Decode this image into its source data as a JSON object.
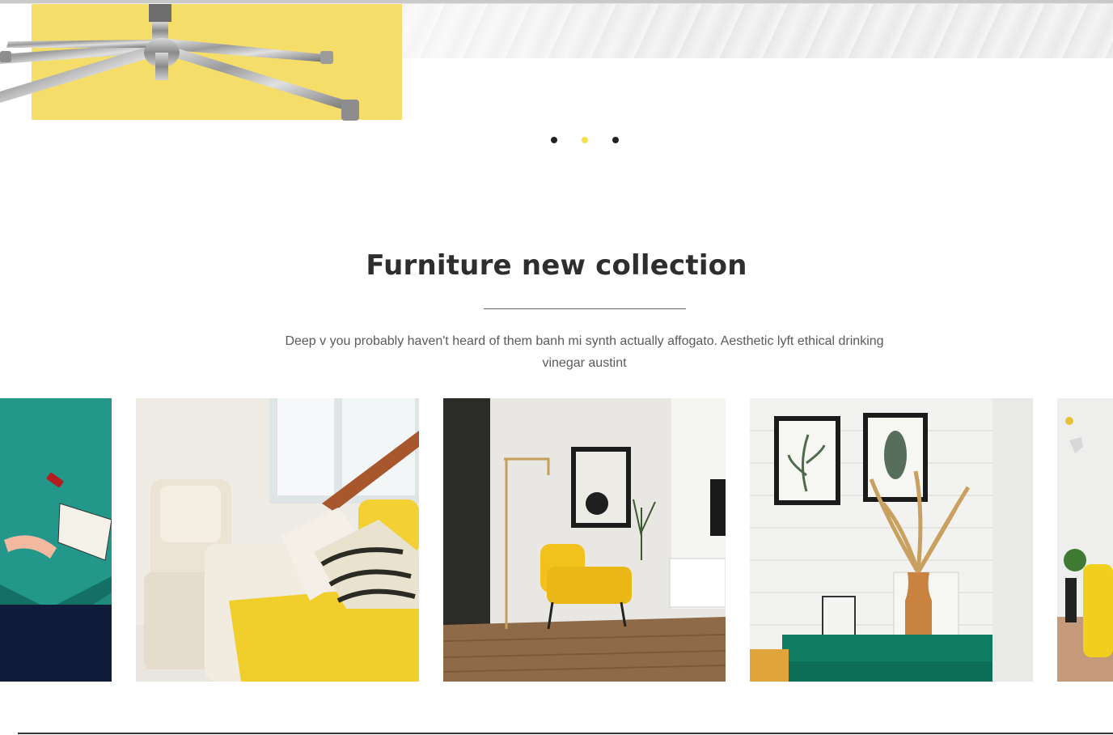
{
  "slider": {
    "dots": [
      {
        "label": "slide-1",
        "active": false
      },
      {
        "label": "slide-2",
        "active": true
      },
      {
        "label": "slide-3",
        "active": false
      }
    ],
    "active_color": "#f3e04a",
    "inactive_color": "#222222"
  },
  "section": {
    "title": "Furniture new collection",
    "description": "Deep v you probably haven't heard of them banh mi synth actually affogato. Aesthetic lyft ethical drinking vinegar austint"
  },
  "gallery": {
    "items": [
      {
        "name": "teal-desk-flatlay",
        "icon": "photo-icon"
      },
      {
        "name": "yellow-sofa-armchair-stairs",
        "icon": "photo-icon"
      },
      {
        "name": "yellow-armchair-floor-lamp",
        "icon": "photo-icon"
      },
      {
        "name": "green-console-dried-grass-vase",
        "icon": "photo-icon"
      },
      {
        "name": "yellow-sofa-plants",
        "icon": "photo-icon"
      }
    ]
  },
  "colors": {
    "hero_yellow": "#f5dd6a",
    "heading": "#2e2e2e",
    "body_text": "#5a5a5a",
    "accent_teal": "#1f8f7f"
  }
}
